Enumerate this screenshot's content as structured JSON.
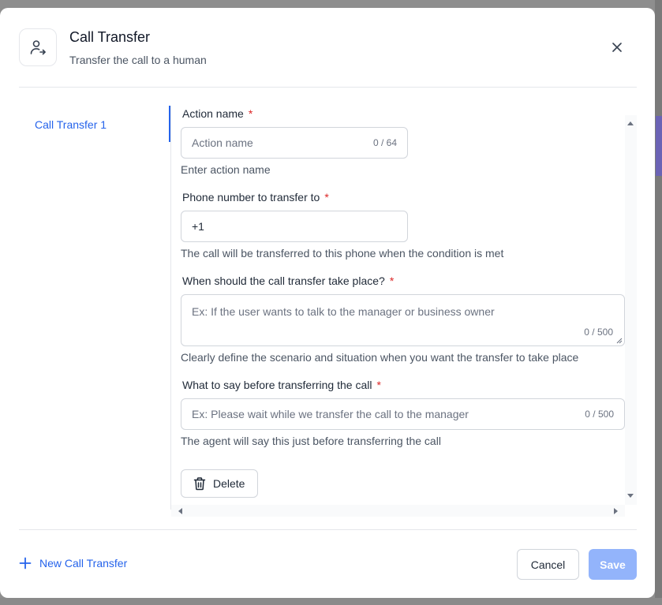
{
  "header": {
    "title": "Call Transfer",
    "subtitle": "Transfer the call to a human",
    "icon": "user-transfer-icon"
  },
  "sidebar": {
    "items": [
      {
        "label": "Call Transfer 1",
        "active": true
      }
    ]
  },
  "form": {
    "action_name": {
      "label": "Action name",
      "required_mark": "*",
      "placeholder": "Action name",
      "value": "",
      "counter": "0 / 64",
      "helper": "Enter action name"
    },
    "phone_number": {
      "label": "Phone number to transfer to",
      "required_mark": "*",
      "value": "+1",
      "helper": "The call will be transferred to this phone when the condition is met"
    },
    "condition": {
      "label": "When should the call transfer take place?",
      "required_mark": "*",
      "placeholder": "Ex: If the user wants to talk to the manager or business owner",
      "value": "",
      "counter": "0 / 500",
      "helper": "Clearly define the scenario and situation when you want the transfer to take place"
    },
    "pre_transfer_message": {
      "label": "What to say before transferring the call",
      "required_mark": "*",
      "placeholder": "Ex: Please wait while we transfer the call to the manager",
      "value": "",
      "counter": "0 / 500",
      "helper": "The agent will say this just before transferring the call"
    },
    "delete_label": "Delete"
  },
  "footer": {
    "new_transfer_label": "New Call Transfer",
    "cancel_label": "Cancel",
    "save_label": "Save"
  },
  "colors": {
    "accent": "#2563eb",
    "required": "#dc2626",
    "save_disabled": "#93b4fb"
  }
}
